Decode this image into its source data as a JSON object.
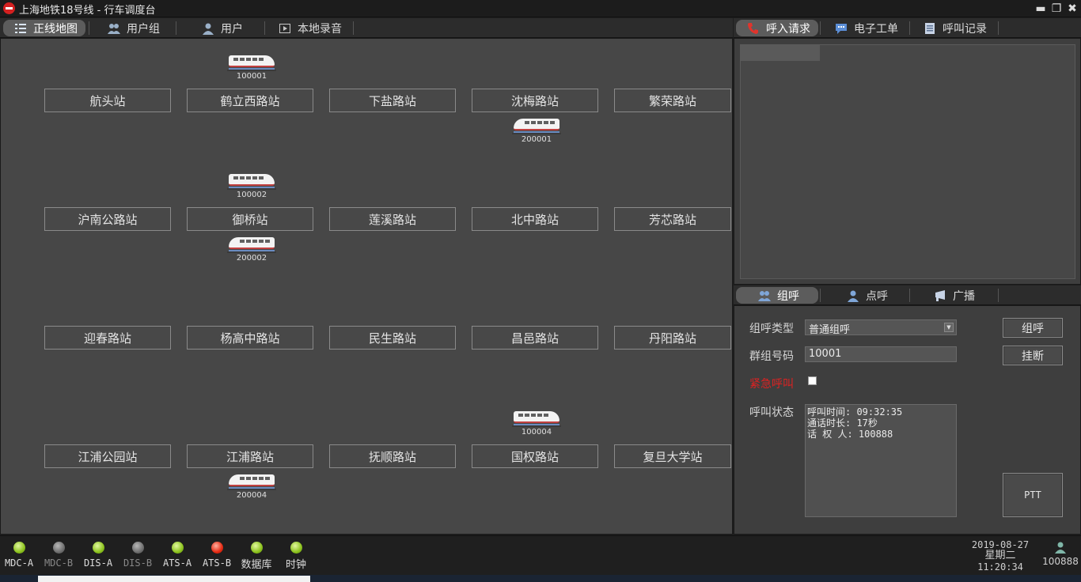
{
  "window": {
    "title": "上海地铁18号线 - 行车调度台"
  },
  "nav_left": [
    {
      "label": "正线地图",
      "icon": "list-icon",
      "active": true
    },
    {
      "label": "用户组",
      "icon": "user-group-icon",
      "active": false
    },
    {
      "label": "用户",
      "icon": "user-icon",
      "active": false
    },
    {
      "label": "本地录音",
      "icon": "recording-icon",
      "active": false
    }
  ],
  "nav_right": [
    {
      "label": "呼入请求",
      "icon": "phone-icon",
      "active": true
    },
    {
      "label": "电子工单",
      "icon": "chat-icon",
      "active": false
    },
    {
      "label": "呼叫记录",
      "icon": "log-icon",
      "active": false
    }
  ],
  "map": {
    "rows": [
      [
        "航头站",
        "鹤立西路站",
        "下盐路站",
        "沈梅路站",
        "繁荣路站"
      ],
      [
        "沪南公路站",
        "御桥站",
        "莲溪路站",
        "北中路站",
        "芳芯路站"
      ],
      [
        "迎春路站",
        "杨高中路站",
        "民生路站",
        "昌邑路站",
        "丹阳路站"
      ],
      [
        "江浦公园站",
        "江浦路站",
        "抚顺路站",
        "国权路站",
        "复旦大学站"
      ]
    ],
    "trains": [
      {
        "id": "100001",
        "row": 0,
        "col": 1,
        "side": "above",
        "direction": "left"
      },
      {
        "id": "200001",
        "row": 0,
        "col": 3,
        "side": "below",
        "direction": "right"
      },
      {
        "id": "100002",
        "row": 1,
        "col": 1,
        "side": "above",
        "direction": "left"
      },
      {
        "id": "200002",
        "row": 1,
        "col": 1,
        "side": "below",
        "direction": "right"
      },
      {
        "id": "100004",
        "row": 3,
        "col": 3,
        "side": "above",
        "direction": "left"
      },
      {
        "id": "200004",
        "row": 3,
        "col": 1,
        "side": "below",
        "direction": "right"
      }
    ]
  },
  "call_nav": [
    {
      "label": "组呼",
      "icon": "group-call-icon",
      "active": true
    },
    {
      "label": "点呼",
      "icon": "user-icon",
      "active": false
    },
    {
      "label": "广播",
      "icon": "broadcast-icon",
      "active": false
    }
  ],
  "call_form": {
    "type_label": "组呼类型",
    "type_value": "普通组呼",
    "group_label": "群组号码",
    "group_value": "10001",
    "emergency_label": "紧急呼叫",
    "emergency_checked": false,
    "status_label": "呼叫状态",
    "status_lines": [
      "呼叫时间: 09:32:35",
      "通话时长: 17秒",
      "话 权 人: 100888"
    ],
    "call_button": "组呼",
    "hangup_button": "挂断",
    "ptt_button": "PTT"
  },
  "status_indicators": [
    {
      "label": "MDC-A",
      "state": "green"
    },
    {
      "label": "MDC-B",
      "state": "gray"
    },
    {
      "label": "DIS-A",
      "state": "green"
    },
    {
      "label": "DIS-B",
      "state": "gray"
    },
    {
      "label": "ATS-A",
      "state": "green"
    },
    {
      "label": "ATS-B",
      "state": "red"
    },
    {
      "label": "数据库",
      "state": "green"
    },
    {
      "label": "时钟",
      "state": "green"
    }
  ],
  "clock": {
    "date": "2019-08-27",
    "weekday": "星期二",
    "time": "11:20:34"
  },
  "user": {
    "id": "100888",
    "icon": "user-icon"
  },
  "colors": {
    "accent_red": "#d42020",
    "indicator_green": "#8cc21d",
    "indicator_red": "#e52a12",
    "indicator_gray": "#6e6e6e"
  }
}
